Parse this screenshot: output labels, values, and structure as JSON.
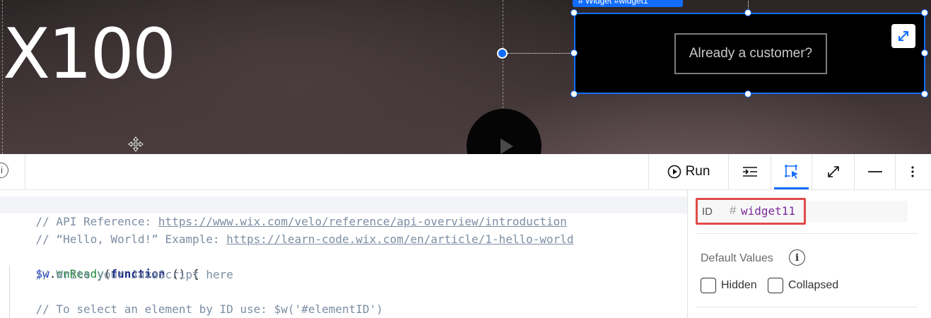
{
  "canvas": {
    "hero_title": "X100",
    "widget_tag": "# Widget  #widget1",
    "customer_button": "Already a customer?",
    "stretch_icon": "expand-arrows-icon",
    "move_icon": "move-cross-icon",
    "play_icon": "play-icon"
  },
  "toolbar": {
    "info_icon": "i",
    "run_label": "Run",
    "buttons": [
      "align-indent-icon",
      "select-element-icon",
      "expand-icon",
      "minimize-icon",
      "more-icon"
    ],
    "accent": "#116dff"
  },
  "code": {
    "lines": [
      {
        "comment_prefix": "// API Reference: ",
        "link": "https://www.wix.com/velo/reference/api-overview/introduction"
      },
      {
        "comment_prefix": "// “Hello, World!” Example: ",
        "link": "https://learn-code.wix.com/en/article/1-hello-world"
      },
      {
        "selector": "$w",
        "dot": ".",
        "method": "onReady",
        "paren_open": "(",
        "keyword": "function",
        "rest": " () {"
      },
      {
        "text": "    // Write your JavaScript here"
      },
      {
        "text": "    // To select an element by ID use: $w('#elementID')"
      }
    ]
  },
  "properties": {
    "id_label": "ID",
    "id_hash": "#",
    "id_value": "widget11",
    "default_values_title": "Default Values",
    "info_icon": "i",
    "hidden_label": "Hidden",
    "collapsed_label": "Collapsed",
    "hidden_checked": false,
    "collapsed_checked": false,
    "highlight_color": "#e34a4a"
  }
}
